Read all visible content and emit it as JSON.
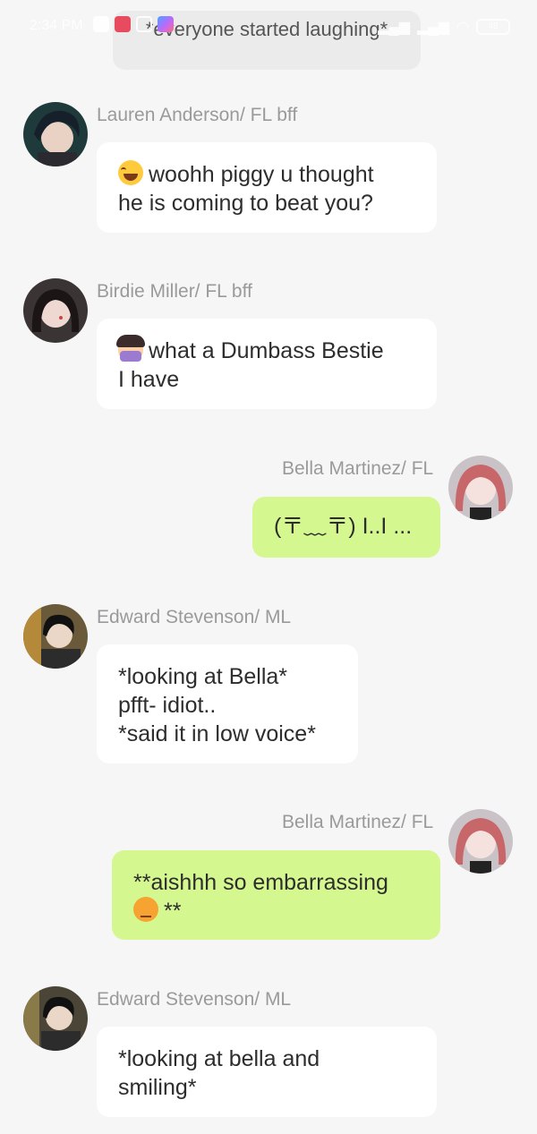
{
  "status_bar": {
    "time": "2:34 PM",
    "icons_left": [
      "weather-icon",
      "youtube-icon",
      "mangatoon-icon",
      "instagram-icon",
      "gallery-icon"
    ],
    "icons_right": [
      "signal-icon",
      "signal-icon",
      "wifi-icon",
      "battery-icon"
    ],
    "battery": "48"
  },
  "narration": "*everyone started laughing*",
  "messages": [
    {
      "sender": "Lauren Anderson/ FL bff",
      "side": "left",
      "emoji": "laughing-tears-emoji",
      "lines": [
        "woohh piggy u thought",
        "he is coming to beat you?"
      ]
    },
    {
      "sender": "Birdie Miller/ FL bff",
      "side": "left",
      "emoji": "facepalm-emoji",
      "lines": [
        "what a Dumbass Bestie",
        "I have"
      ]
    },
    {
      "sender": "Bella Martinez/ FL",
      "side": "right",
      "lines": [
        "(〒﹏〒) I..I ..."
      ]
    },
    {
      "sender": "Edward Stevenson/ ML",
      "side": "left",
      "lines": [
        "*looking at Bella*",
        "pfft- idiot..",
        "*said it in low voice*"
      ]
    },
    {
      "sender": "Bella Martinez/ FL",
      "side": "right",
      "emoji": "confounded-emoji",
      "lines": [
        "**aishhh so embarrassing",
        "**"
      ]
    },
    {
      "sender": "Edward Stevenson/ ML",
      "side": "left",
      "lines": [
        "*looking at bella and",
        "smiling*"
      ]
    }
  ],
  "colors": {
    "background": "#f6f6f6",
    "bubble_other": "#ffffff",
    "bubble_me": "#d5f790",
    "name_text": "#9a9a9a"
  }
}
